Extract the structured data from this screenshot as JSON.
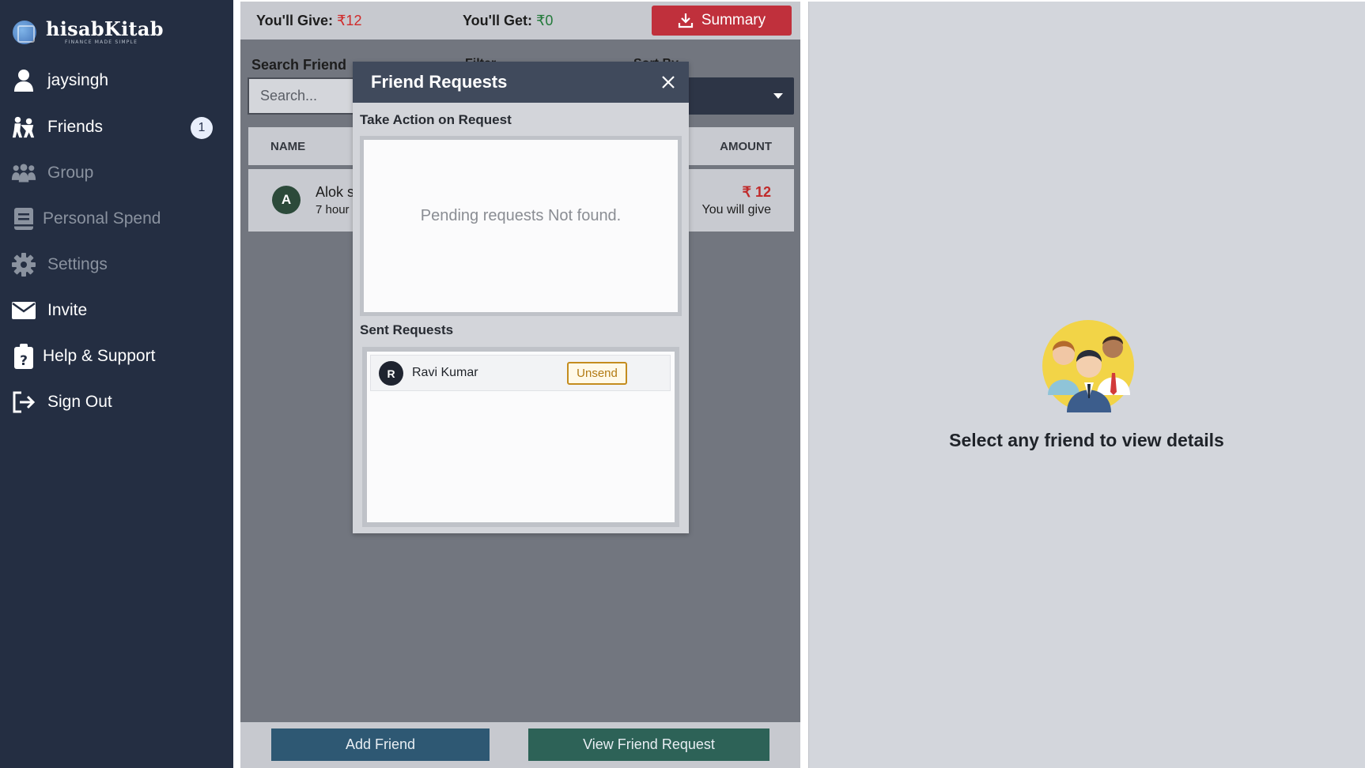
{
  "app": {
    "logo_name": "hisabKitab",
    "logo_tagline": "FINANCE MADE SIMPLE"
  },
  "sidebar": {
    "items": [
      {
        "label": "jaysingh",
        "icon": "user-icon"
      },
      {
        "label": "Friends",
        "icon": "friends-icon",
        "badge": "1"
      },
      {
        "label": "Group",
        "icon": "group-icon"
      },
      {
        "label": "Personal Spend",
        "icon": "notebook-icon"
      },
      {
        "label": "Settings",
        "icon": "gear-icon"
      },
      {
        "label": "Invite",
        "icon": "envelope-icon"
      },
      {
        "label": "Help & Support",
        "icon": "clipboard-help-icon"
      },
      {
        "label": "Sign Out",
        "icon": "sign-out-icon"
      }
    ]
  },
  "summary": {
    "give_label": "You'll Give:",
    "give_amount": "₹12",
    "get_label": "You'll Get:",
    "get_amount": "₹0",
    "button_label": "Summary"
  },
  "filters": {
    "search_label": "Search Friend",
    "search_placeholder": "Search...",
    "filter_label": "Filter",
    "sort_label": "Sort By"
  },
  "table": {
    "headers": {
      "name": "NAME",
      "amount": "AMOUNT"
    },
    "rows": [
      {
        "initial": "A",
        "name": "Alok s",
        "time": "7 hour",
        "amount": "₹ 12",
        "status": "You will give"
      }
    ]
  },
  "bottom": {
    "add_friend": "Add Friend",
    "view_request": "View Friend Request"
  },
  "right_panel": {
    "message": "Select any friend to view details"
  },
  "modal": {
    "title": "Friend Requests",
    "take_action_title": "Take Action on Request",
    "pending_empty": "Pending requests Not found.",
    "sent_title": "Sent Requests",
    "sent": [
      {
        "initial": "R",
        "name": "Ravi Kumar",
        "action": "Unsend"
      }
    ]
  },
  "colors": {
    "sidebar_bg": "#242e42",
    "give_red": "#d02a2a",
    "get_green": "#237a3b",
    "summary_button": "#c0303c",
    "modal_header": "#404a5c"
  }
}
